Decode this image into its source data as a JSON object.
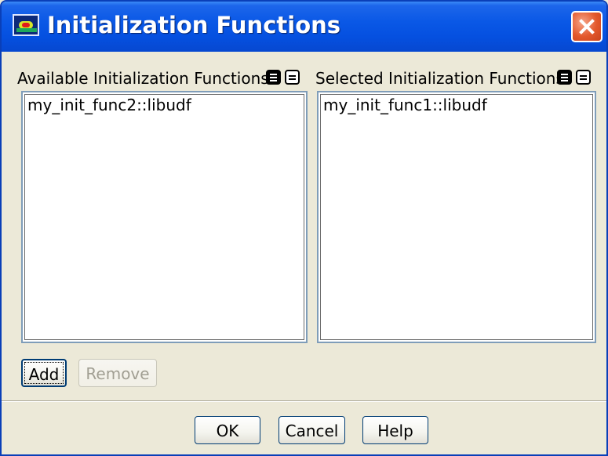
{
  "window": {
    "title": "Initialization Functions",
    "icon": "fluent-app-icon",
    "close_icon": "close-icon"
  },
  "available": {
    "label": "Available Initialization Functions",
    "items": [
      "my_init_func2::libudf"
    ],
    "select_all_icon": "select-all-icon",
    "deselect_all_icon": "deselect-all-icon"
  },
  "selected": {
    "label": "Selected Initialization Functions",
    "items": [
      "my_init_func1::libudf"
    ],
    "select_all_icon": "select-all-icon",
    "deselect_all_icon": "deselect-all-icon"
  },
  "actions": {
    "add": "Add",
    "remove": "Remove",
    "remove_disabled": true
  },
  "footer": {
    "ok": "OK",
    "cancel": "Cancel",
    "help": "Help"
  },
  "colors": {
    "titlebar": "#0550e0",
    "dialog_bg": "#ece9d8",
    "close_button": "#e3582c",
    "list_border": "#7f9db9"
  }
}
